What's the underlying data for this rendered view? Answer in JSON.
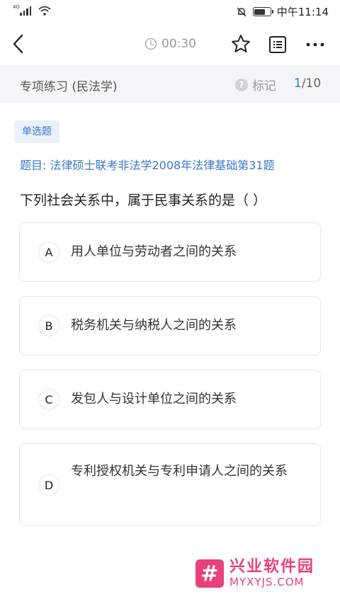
{
  "status_bar": {
    "network": "4G",
    "time": "中午11:14"
  },
  "nav": {
    "timer": "00:30"
  },
  "sub_header": {
    "title": "专项练习 (民法学)",
    "mark_label": "标记",
    "progress_current": "1",
    "progress_total": "/10"
  },
  "question": {
    "type": "单选题",
    "source": "题目: 法律硕士联考非法学2008年法律基础第31题",
    "stem": "下列社会关系中，属于民事关系的是（ ）",
    "options": [
      {
        "letter": "A",
        "text": "用人单位与劳动者之间的关系"
      },
      {
        "letter": "B",
        "text": "税务机关与纳税人之间的关系"
      },
      {
        "letter": "C",
        "text": "发包人与设计单位之间的关系"
      },
      {
        "letter": "D",
        "text": "专利授权机关与专利申请人之间的关系"
      }
    ]
  },
  "watermark": {
    "logo_char": "#",
    "name": "兴业软件园",
    "url": "MYXYJS.COM"
  },
  "colors": {
    "accent": "#3a78c9",
    "sub_header_bg": "#f3f5f8",
    "watermark": "#e8417b"
  }
}
